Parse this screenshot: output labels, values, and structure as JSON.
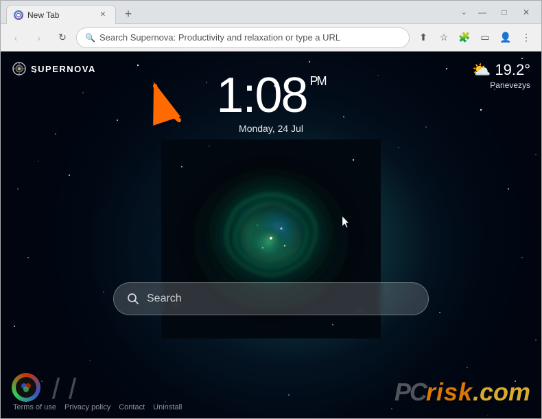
{
  "browser": {
    "tab_title": "New Tab",
    "tab_favicon": "★",
    "new_tab_btn": "+",
    "window_controls": {
      "minimize": "—",
      "maximize": "□",
      "close": "✕"
    },
    "nav": {
      "back": "‹",
      "forward": "›",
      "refresh": "↻",
      "address_placeholder": "Search Supernova: Productivity and relaxation or type a URL"
    }
  },
  "page": {
    "logo": {
      "text": "SUPERNOVA"
    },
    "clock": {
      "hours": "1:08",
      "ampm": "PM",
      "date": "Monday, 24 Jul"
    },
    "weather": {
      "icon": "⛅",
      "temperature": "19.2°",
      "city": "Panevezys"
    },
    "search": {
      "placeholder": "Search"
    },
    "footer": {
      "links": [
        "Terms of use",
        "Privacy policy",
        "Contact",
        "Uninstall"
      ],
      "brand": "PC",
      "risk": "risk",
      "com": ".com"
    }
  }
}
